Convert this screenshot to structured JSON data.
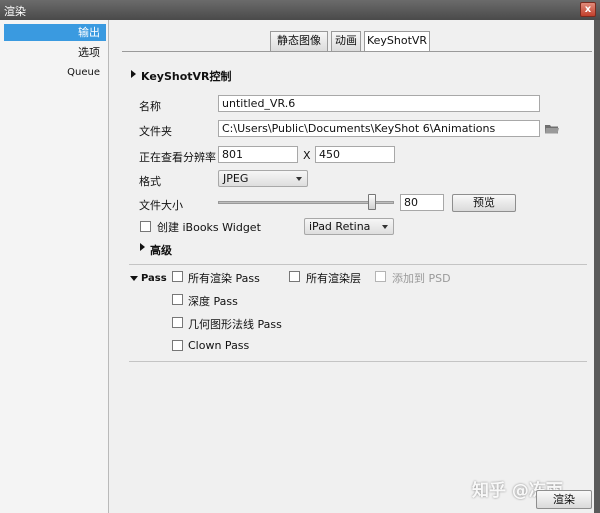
{
  "window": {
    "title": "渲染",
    "close_glyph": "x"
  },
  "sidebar": {
    "items": [
      {
        "label": "输出",
        "active": true
      },
      {
        "label": "选项",
        "active": false
      },
      {
        "label": "Queue",
        "active": false
      }
    ]
  },
  "tabs": [
    {
      "label": "静态图像",
      "active": false
    },
    {
      "label": "动画",
      "active": false
    },
    {
      "label": "KeyShotVR",
      "active": true
    }
  ],
  "keyshotvr": {
    "section_title": "KeyShotVR控制",
    "name_label": "名称",
    "name_value": "untitled_VR.6",
    "folder_label": "文件夹",
    "folder_value": "C:\\Users\\Public\\Documents\\KeyShot 6\\Animations",
    "folder_icon": "folder-icon",
    "resolution_label": "正在查看分辨率",
    "res_width": "801",
    "res_separator": "X",
    "res_height": "450",
    "format_label": "格式",
    "format_value": "JPEG",
    "filesize_label": "文件大小",
    "filesize_value": "80",
    "filesize_slider_level": 0.89,
    "preview_button": "预览",
    "ibooks_label": "创建 iBooks Widget",
    "ibooks_checked": false,
    "device_value": "iPad Retina",
    "advanced_label": "高级"
  },
  "pass": {
    "title": "Pass",
    "options": [
      {
        "label": "所有渲染 Pass",
        "checked": false,
        "enabled": true
      },
      {
        "label": "所有渲染层",
        "checked": false,
        "enabled": true
      },
      {
        "label": "添加到 PSD",
        "checked": false,
        "enabled": false
      },
      {
        "label": "深度 Pass",
        "checked": false,
        "enabled": true
      },
      {
        "label": "几何图形法线 Pass",
        "checked": false,
        "enabled": true
      },
      {
        "label": "Clown Pass",
        "checked": false,
        "enabled": true
      }
    ]
  },
  "footer": {
    "render_button": "渲染",
    "watermark": "知乎 @冻雨"
  }
}
